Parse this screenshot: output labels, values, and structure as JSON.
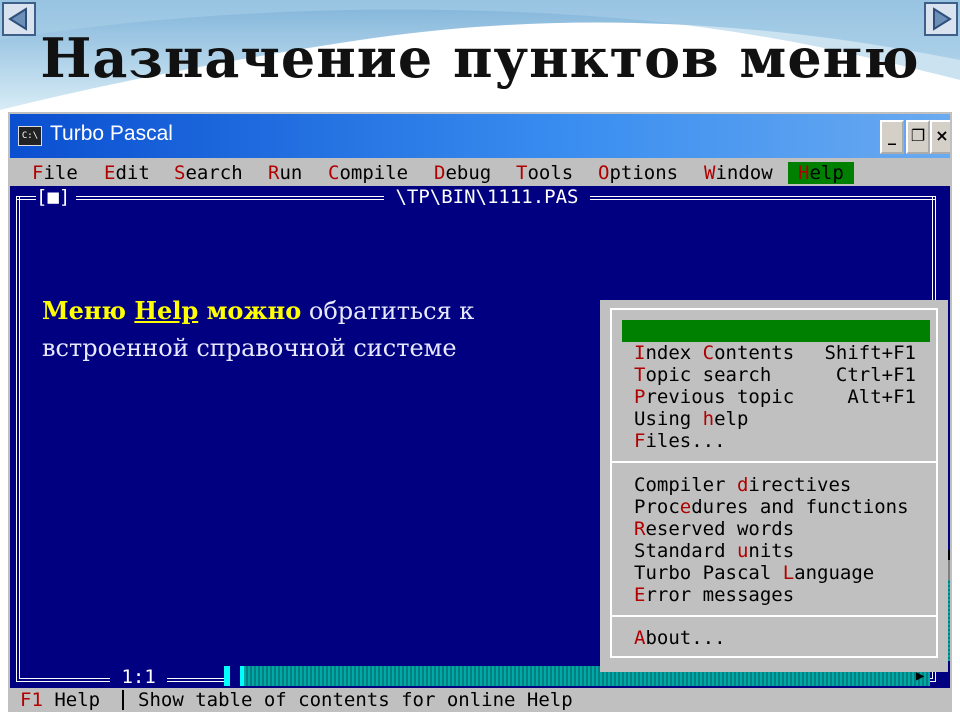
{
  "slide": {
    "title": "Назначение пунктов меню",
    "nav_prev_icon": "triangle-left-icon",
    "nav_next_icon": "triangle-right-icon"
  },
  "window": {
    "title": "Turbo Pascal",
    "icon_text": "C:\\",
    "btn_min": "_",
    "btn_max": "❐",
    "btn_close": "×"
  },
  "menubar": {
    "items": [
      {
        "hotkey": "F",
        "rest": "ile"
      },
      {
        "hotkey": "E",
        "rest": "dit"
      },
      {
        "hotkey": "S",
        "rest": "earch"
      },
      {
        "hotkey": "R",
        "rest": "un"
      },
      {
        "hotkey": "C",
        "rest": "ompile"
      },
      {
        "hotkey": "D",
        "rest": "ebug"
      },
      {
        "hotkey": "T",
        "rest": "ools"
      },
      {
        "hotkey": "O",
        "rest": "ptions"
      },
      {
        "hotkey": "W",
        "rest": "indow"
      },
      {
        "hotkey": "H",
        "rest": "elp"
      }
    ],
    "active": "Help"
  },
  "editor": {
    "close_box": "[■]",
    "file_path": " \\TP\\BIN\\1111.PAS ",
    "position": " 1:1 "
  },
  "description": {
    "part1": "Меню ",
    "part2": "Help",
    "part3": " можно",
    "part4": " обратиться к встроенной справочной системе"
  },
  "help_menu": {
    "group1": [
      {
        "pre": "",
        "hotkey": "C",
        "post": "ontents",
        "shortcut": ""
      },
      {
        "pre": "",
        "hotkey": "I",
        "post": "ndex",
        "shortcut": "Shift+F1"
      },
      {
        "pre": "",
        "hotkey": "T",
        "post": "opic search",
        "shortcut": "Ctrl+F1"
      },
      {
        "pre": "",
        "hotkey": "P",
        "post": "revious topic",
        "shortcut": "Alt+F1"
      },
      {
        "pre": "Using ",
        "hotkey": "h",
        "post": "elp",
        "shortcut": ""
      },
      {
        "pre": "",
        "hotkey": "F",
        "post": "iles...",
        "shortcut": ""
      }
    ],
    "group2": [
      {
        "pre": "Compiler ",
        "hotkey": "d",
        "post": "irectives",
        "shortcut": ""
      },
      {
        "pre": "Proc",
        "hotkey": "e",
        "post": "dures and functions",
        "shortcut": ""
      },
      {
        "pre": "",
        "hotkey": "R",
        "post": "eserved words",
        "shortcut": ""
      },
      {
        "pre": "Standard ",
        "hotkey": "u",
        "post": "nits",
        "shortcut": ""
      },
      {
        "pre": "Turbo Pascal ",
        "hotkey": "L",
        "post": "anguage",
        "shortcut": ""
      },
      {
        "pre": "",
        "hotkey": "E",
        "post": "rror messages",
        "shortcut": ""
      }
    ],
    "group3": [
      {
        "pre": "",
        "hotkey": "A",
        "post": "bout...",
        "shortcut": ""
      }
    ],
    "selected": "Contents"
  },
  "statusbar": {
    "f1_key": "F1",
    "f1_label": " Help",
    "message": "Show table of contents for online Help"
  },
  "colors": {
    "editor_bg": "#000080",
    "menu_bg": "#c0c0c0",
    "highlight": "#008000",
    "hotkey": "#b00000",
    "titlebar": "#0a4fd0"
  }
}
